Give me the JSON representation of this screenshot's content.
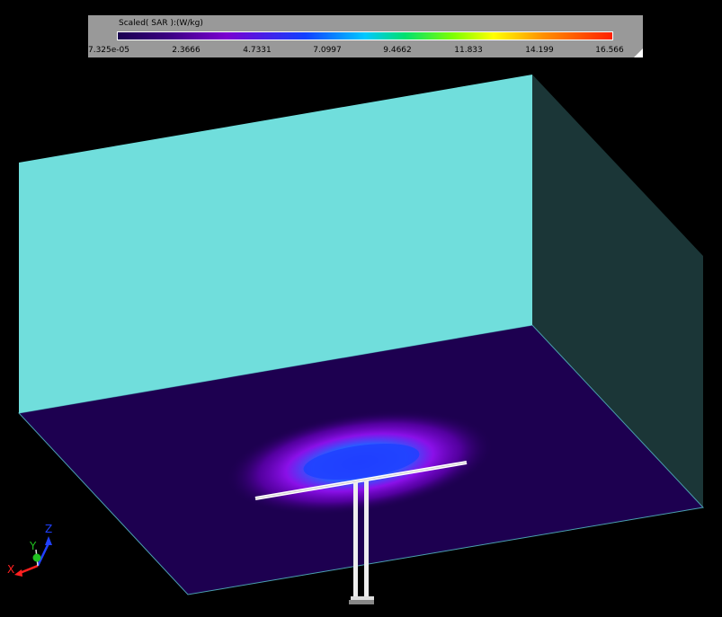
{
  "legend": {
    "title": "Scaled( SAR ):(W/kg)",
    "ticks": [
      "7.325e-05",
      "2.3666",
      "4.7331",
      "7.0997",
      "9.4662",
      "11.833",
      "14.199",
      "16.566"
    ]
  },
  "axes": {
    "x": "X",
    "y": "Y",
    "z": "Z"
  },
  "colors": {
    "box_front": "#70dedc",
    "box_side": "#1b3637",
    "floor": "#1d0050",
    "antenna": "#ffffff",
    "axis_x": "#ff2020",
    "axis_y": "#20c020",
    "axis_z": "#2040ff"
  }
}
